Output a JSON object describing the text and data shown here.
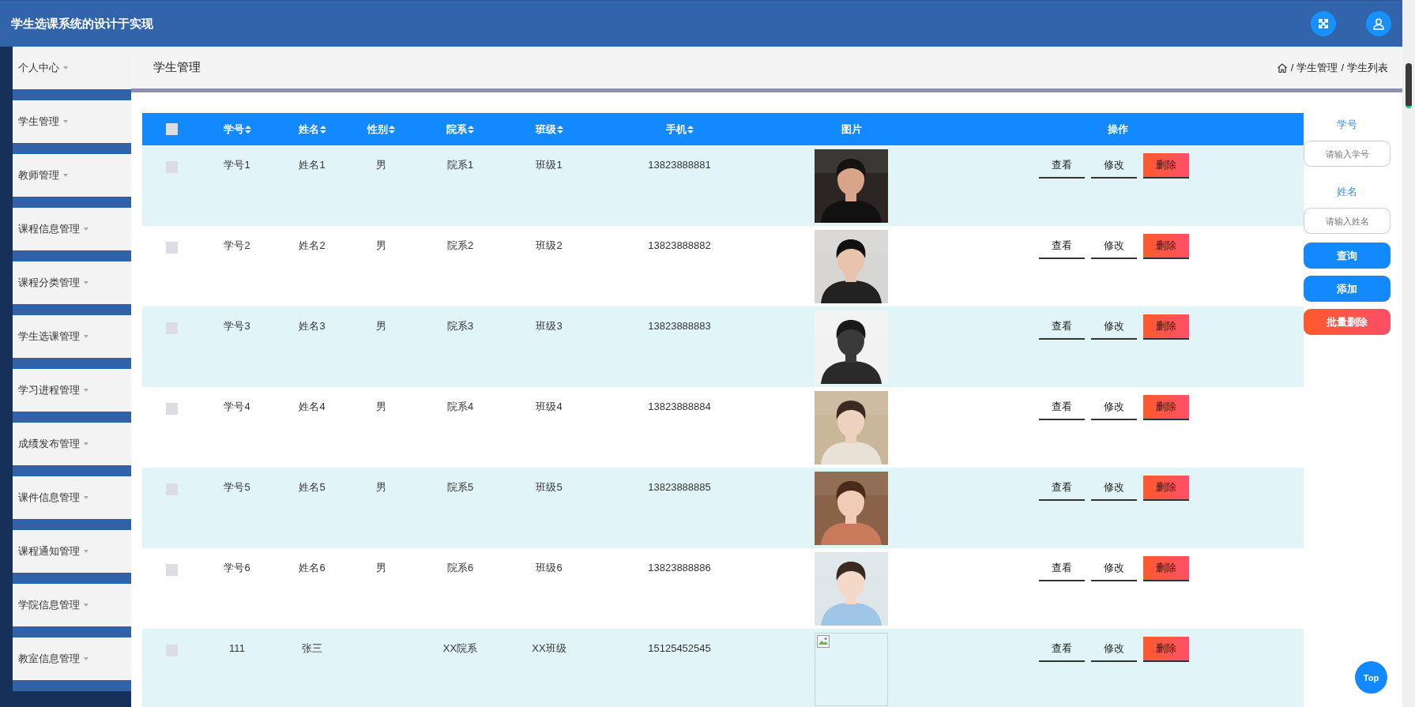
{
  "header": {
    "title": "学生选课系统的设计于实现"
  },
  "sidebar": {
    "items": [
      {
        "label": "个人中心",
        "selected": false
      },
      {
        "label": "学生管理",
        "selected": false
      },
      {
        "label": "教师管理",
        "selected": false
      },
      {
        "label": "课程信息管理",
        "selected": false
      },
      {
        "label": "课程分类管理",
        "selected": false
      },
      {
        "label": "学生选课管理",
        "selected": false
      },
      {
        "label": "学习进程管理",
        "selected": false
      },
      {
        "label": "成绩发布管理",
        "selected": false
      },
      {
        "label": "课件信息管理",
        "selected": false
      },
      {
        "label": "课程通知管理",
        "selected": false
      },
      {
        "label": "学院信息管理",
        "selected": false
      },
      {
        "label": "教室信息管理",
        "selected": false
      }
    ]
  },
  "page": {
    "title": "学生管理",
    "breadcrumb": {
      "separator": "/",
      "items": [
        "学生管理",
        "学生列表"
      ]
    }
  },
  "table": {
    "select_all": {
      "checked": false
    },
    "columns": [
      {
        "label": "学号",
        "sortable": true
      },
      {
        "label": "姓名",
        "sortable": true
      },
      {
        "label": "性别",
        "sortable": true
      },
      {
        "label": "院系",
        "sortable": true
      },
      {
        "label": "班级",
        "sortable": true
      },
      {
        "label": "手机",
        "sortable": true
      },
      {
        "label": "图片",
        "sortable": false
      },
      {
        "label": "操作",
        "sortable": false
      }
    ],
    "rows": [
      {
        "checked": false,
        "student_id": "学号1",
        "name": "姓名1",
        "gender": "男",
        "department": "院系1",
        "class": "班级1",
        "phone": "13823888881",
        "actions": [
          {
            "label": "查看",
            "kind": "view"
          },
          {
            "label": "修改",
            "kind": "edit"
          },
          {
            "label": "删除",
            "kind": "delete"
          }
        ]
      },
      {
        "checked": false,
        "student_id": "学号2",
        "name": "姓名2",
        "gender": "男",
        "department": "院系2",
        "class": "班级2",
        "phone": "13823888882",
        "actions": [
          {
            "label": "查看",
            "kind": "view"
          },
          {
            "label": "修改",
            "kind": "edit"
          },
          {
            "label": "删除",
            "kind": "delete"
          }
        ]
      },
      {
        "checked": false,
        "student_id": "学号3",
        "name": "姓名3",
        "gender": "男",
        "department": "院系3",
        "class": "班级3",
        "phone": "13823888883",
        "actions": [
          {
            "label": "查看",
            "kind": "view"
          },
          {
            "label": "修改",
            "kind": "edit"
          },
          {
            "label": "删除",
            "kind": "delete"
          }
        ]
      },
      {
        "checked": false,
        "student_id": "学号4",
        "name": "姓名4",
        "gender": "男",
        "department": "院系4",
        "class": "班级4",
        "phone": "13823888884",
        "actions": [
          {
            "label": "查看",
            "kind": "view"
          },
          {
            "label": "修改",
            "kind": "edit"
          },
          {
            "label": "删除",
            "kind": "delete"
          }
        ]
      },
      {
        "checked": false,
        "student_id": "学号5",
        "name": "姓名5",
        "gender": "男",
        "department": "院系5",
        "class": "班级5",
        "phone": "13823888885",
        "actions": [
          {
            "label": "查看",
            "kind": "view"
          },
          {
            "label": "修改",
            "kind": "edit"
          },
          {
            "label": "删除",
            "kind": "delete"
          }
        ]
      },
      {
        "checked": false,
        "student_id": "学号6",
        "name": "姓名6",
        "gender": "男",
        "department": "院系6",
        "class": "班级6",
        "phone": "13823888886",
        "actions": [
          {
            "label": "查看",
            "kind": "view"
          },
          {
            "label": "修改",
            "kind": "edit"
          },
          {
            "label": "删除",
            "kind": "delete"
          }
        ]
      },
      {
        "checked": false,
        "student_id": "111",
        "name": "张三",
        "department": "XX院系",
        "class": "XX班级",
        "phone": "15125452545",
        "photo": {
          "kind": "broken"
        },
        "actions": [
          {
            "label": "查看",
            "kind": "view"
          },
          {
            "label": "修改",
            "kind": "edit"
          },
          {
            "label": "删除",
            "kind": "delete"
          }
        ]
      }
    ]
  },
  "search": {
    "fields": [
      {
        "label": "学号",
        "placeholder": "请输入学号"
      },
      {
        "label": "姓名",
        "placeholder": "请输入姓名"
      }
    ],
    "buttons": [
      {
        "label": "查询",
        "kind": "primary"
      },
      {
        "label": "添加",
        "kind": "primary"
      },
      {
        "label": "批量删除",
        "kind": "danger"
      }
    ]
  },
  "back_to_top": {
    "label": "Top"
  }
}
